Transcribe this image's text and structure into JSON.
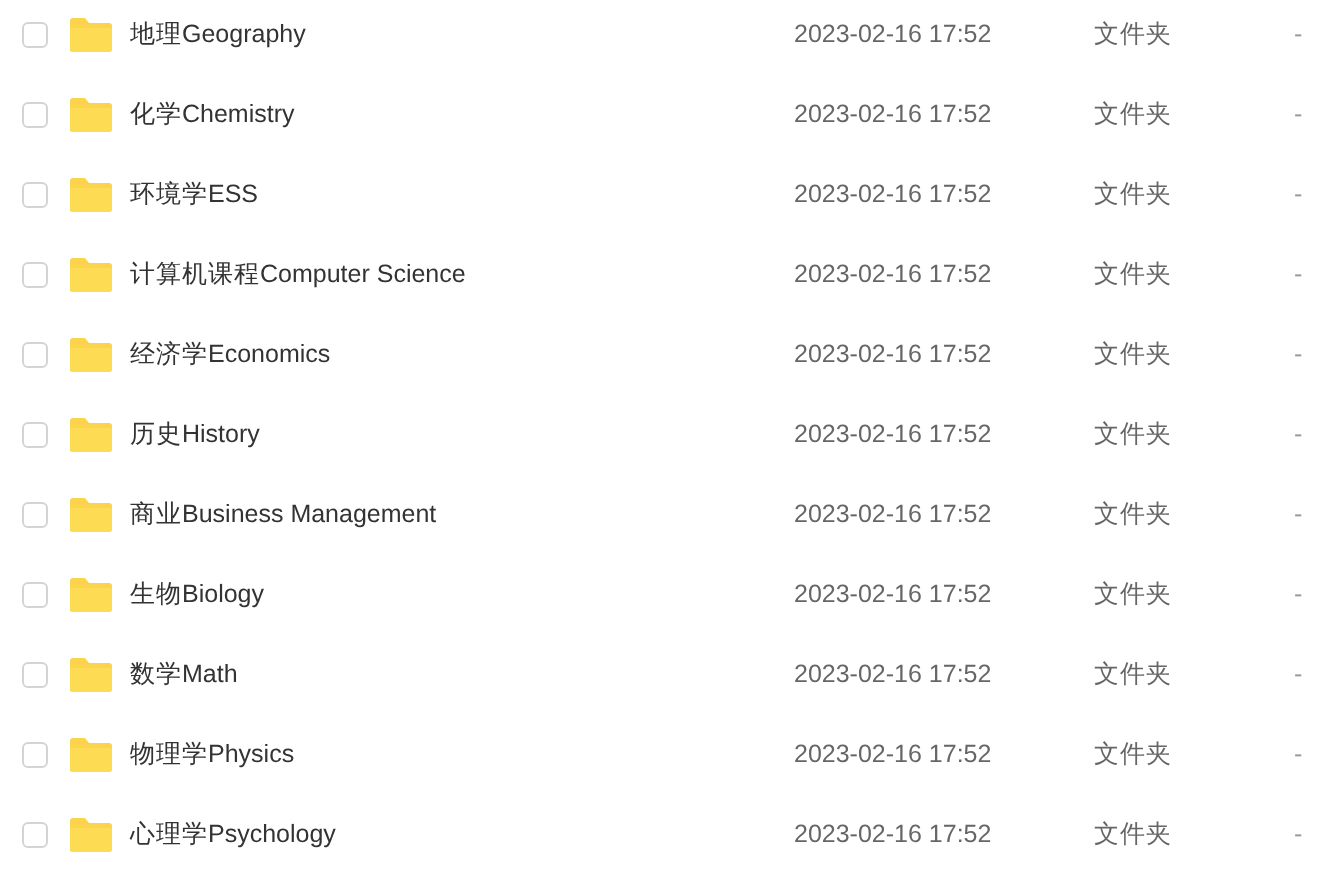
{
  "files": [
    {
      "name": "地理Geography",
      "checked": false,
      "modified": "2023-02-16 17:52",
      "type": "文件夹",
      "size": "-"
    },
    {
      "name": "化学Chemistry",
      "checked": false,
      "modified": "2023-02-16 17:52",
      "type": "文件夹",
      "size": "-"
    },
    {
      "name": "环境学ESS",
      "checked": false,
      "modified": "2023-02-16 17:52",
      "type": "文件夹",
      "size": "-"
    },
    {
      "name": "计算机课程Computer Science",
      "checked": false,
      "modified": "2023-02-16 17:52",
      "type": "文件夹",
      "size": "-"
    },
    {
      "name": "经济学Economics",
      "checked": false,
      "modified": "2023-02-16 17:52",
      "type": "文件夹",
      "size": "-"
    },
    {
      "name": "历史History",
      "checked": false,
      "modified": "2023-02-16 17:52",
      "type": "文件夹",
      "size": "-"
    },
    {
      "name": "商业Business Management",
      "checked": false,
      "modified": "2023-02-16 17:52",
      "type": "文件夹",
      "size": "-"
    },
    {
      "name": "生物Biology",
      "checked": false,
      "modified": "2023-02-16 17:52",
      "type": "文件夹",
      "size": "-"
    },
    {
      "name": "数学Math",
      "checked": false,
      "modified": "2023-02-16 17:52",
      "type": "文件夹",
      "size": "-"
    },
    {
      "name": "物理学Physics",
      "checked": false,
      "modified": "2023-02-16 17:52",
      "type": "文件夹",
      "size": "-"
    },
    {
      "name": "心理学Psychology",
      "checked": false,
      "modified": "2023-02-16 17:52",
      "type": "文件夹",
      "size": "-"
    }
  ]
}
